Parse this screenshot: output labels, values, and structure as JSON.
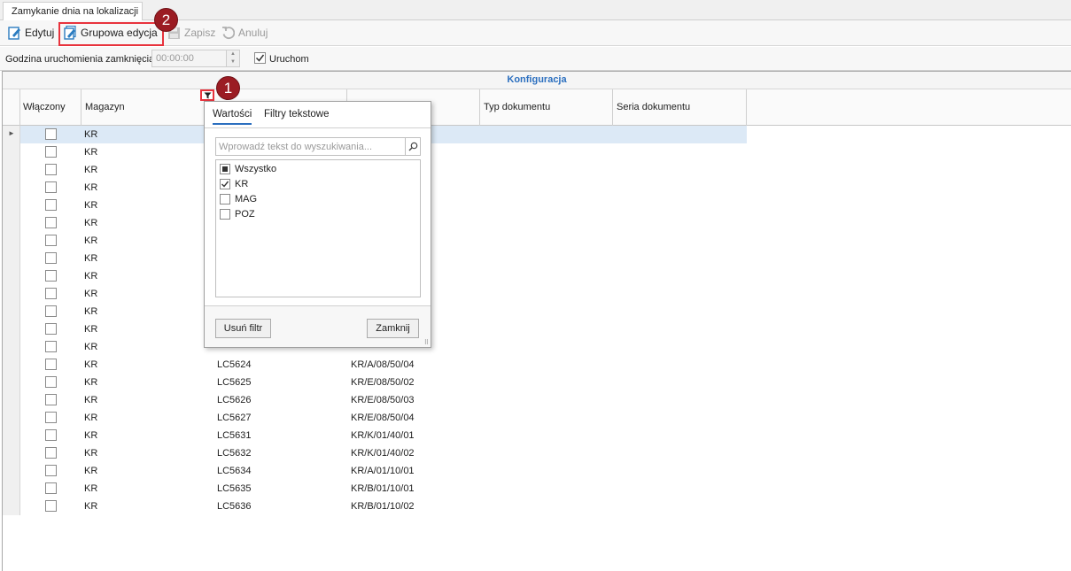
{
  "tab": {
    "title": "Zamykanie dnia na lokalizacji"
  },
  "toolbar": {
    "edit_label": "Edytuj",
    "group_edit_label": "Grupowa edycja",
    "save_label": "Zapisz",
    "cancel_label": "Anuluj"
  },
  "settings": {
    "time_label": "Godzina uruchomienia zamknięcia",
    "time_value": "00:00:00",
    "run_label": "Uruchom",
    "run_checked": true
  },
  "badges": {
    "one": "1",
    "two": "2"
  },
  "grid": {
    "band_title": "Konfiguracja",
    "columns": {
      "enabled": "Włączony",
      "warehouse": "Magazyn",
      "doc_type": "Typ dokumentu",
      "doc_series": "Seria dokumentu"
    },
    "rows": [
      {
        "mag": "KR",
        "code": "",
        "loc": ""
      },
      {
        "mag": "KR",
        "code": "",
        "loc": ""
      },
      {
        "mag": "KR",
        "code": "",
        "loc": ""
      },
      {
        "mag": "KR",
        "code": "",
        "loc": ""
      },
      {
        "mag": "KR",
        "code": "",
        "loc": ""
      },
      {
        "mag": "KR",
        "code": "",
        "loc": ""
      },
      {
        "mag": "KR",
        "code": "",
        "loc": ""
      },
      {
        "mag": "KR",
        "code": "",
        "loc": ""
      },
      {
        "mag": "KR",
        "code": "",
        "loc": ""
      },
      {
        "mag": "KR",
        "code": "",
        "loc": ""
      },
      {
        "mag": "KR",
        "code": "",
        "loc": ""
      },
      {
        "mag": "KR",
        "code": "",
        "loc": ""
      },
      {
        "mag": "KR",
        "code": "",
        "loc": ""
      },
      {
        "mag": "KR",
        "code": "LC5624",
        "loc": "KR/A/08/50/04"
      },
      {
        "mag": "KR",
        "code": "LC5625",
        "loc": "KR/E/08/50/02"
      },
      {
        "mag": "KR",
        "code": "LC5626",
        "loc": "KR/E/08/50/03"
      },
      {
        "mag": "KR",
        "code": "LC5627",
        "loc": "KR/E/08/50/04"
      },
      {
        "mag": "KR",
        "code": "LC5631",
        "loc": "KR/K/01/40/01"
      },
      {
        "mag": "KR",
        "code": "LC5632",
        "loc": "KR/K/01/40/02"
      },
      {
        "mag": "KR",
        "code": "LC5634",
        "loc": "KR/A/01/10/01"
      },
      {
        "mag": "KR",
        "code": "LC5635",
        "loc": "KR/B/01/10/01"
      },
      {
        "mag": "KR",
        "code": "LC5636",
        "loc": "KR/B/01/10/02"
      }
    ]
  },
  "filter_popup": {
    "tab_values": "Wartości",
    "tab_text_filters": "Filtry tekstowe",
    "search_placeholder": "Wprowadź tekst do wyszukiwania...",
    "items": [
      {
        "label": "Wszystko",
        "state": "indeterminate"
      },
      {
        "label": "KR",
        "state": "checked"
      },
      {
        "label": "MAG",
        "state": "unchecked"
      },
      {
        "label": "POZ",
        "state": "unchecked"
      }
    ],
    "clear_label": "Usuń filtr",
    "close_label": "Zamknij"
  },
  "colors": {
    "accent": "#2b6fbf",
    "highlight": "#e8333d",
    "badge": "#9b1c23",
    "selected_row": "#dce9f6"
  }
}
